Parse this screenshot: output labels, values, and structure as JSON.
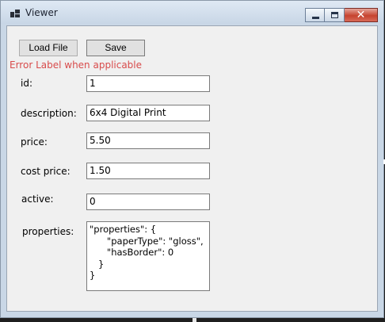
{
  "window": {
    "title": "Viewer",
    "icon": "app-window-icon"
  },
  "toolbar": {
    "load_label": "Load File",
    "save_label": "Save"
  },
  "error_label": "Error Label when applicable",
  "fields": [
    {
      "label": "id:",
      "value": "1"
    },
    {
      "label": "description:",
      "value": "6x4 Digital Print"
    },
    {
      "label": "price:",
      "value": "5.50"
    },
    {
      "label": "cost price:",
      "value": "1.50"
    },
    {
      "label": "active:",
      "value": "0"
    }
  ],
  "properties": {
    "label": "properties:",
    "value": "\"properties\": {\n      \"paperType\": \"gloss\",\n      \"hasBorder\": 0\n   }\n}"
  },
  "colors": {
    "error": "#d84b4b",
    "close_button": "#c6432f"
  }
}
